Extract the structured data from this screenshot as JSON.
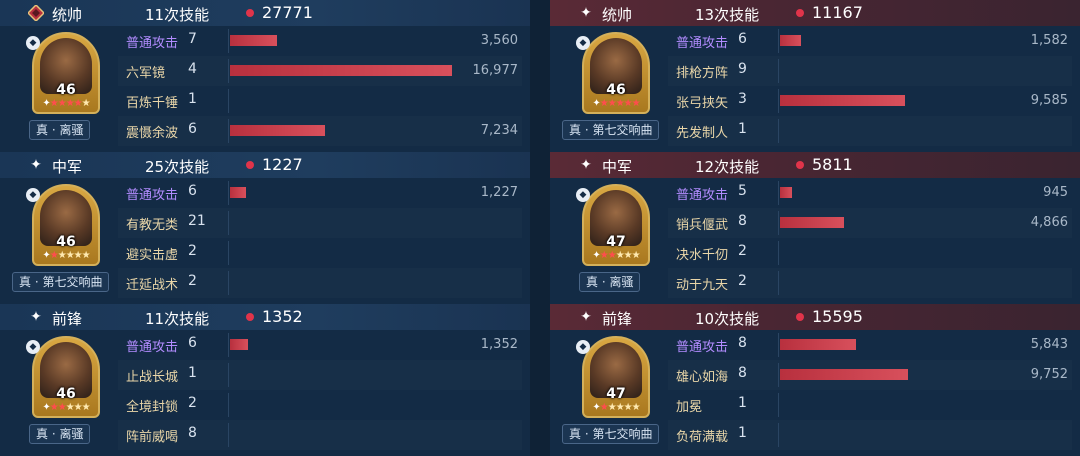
{
  "max_damage": 16977,
  "teams": [
    {
      "side": "left",
      "sections": [
        {
          "role": "统帅",
          "role_icon": "diamond-emblem-icon",
          "skill_count": "11次技能",
          "total": "27771",
          "level": "46",
          "stars_on": 4,
          "tactic": "真 · 离骚",
          "skills": [
            {
              "name": "普通攻击",
              "count": "7",
              "damage": 3560,
              "damage_text": "3,560",
              "basic": true
            },
            {
              "name": "六军镜",
              "count": "4",
              "damage": 16977,
              "damage_text": "16,977"
            },
            {
              "name": "百炼千锤",
              "count": "1",
              "damage": 0,
              "damage_text": ""
            },
            {
              "name": "震慑余波",
              "count": "6",
              "damage": 7234,
              "damage_text": "7,234"
            }
          ]
        },
        {
          "role": "中军",
          "role_icon": "star-icon",
          "skill_count": "25次技能",
          "total": "1227",
          "level": "46",
          "stars_on": 1,
          "tactic": "真 · 第七交响曲",
          "skills": [
            {
              "name": "普通攻击",
              "count": "6",
              "damage": 1227,
              "damage_text": "1,227",
              "basic": true
            },
            {
              "name": "有教无类",
              "count": "21",
              "damage": 0,
              "damage_text": ""
            },
            {
              "name": "避实击虚",
              "count": "2",
              "damage": 0,
              "damage_text": ""
            },
            {
              "name": "迁延战术",
              "count": "2",
              "damage": 0,
              "damage_text": ""
            }
          ]
        },
        {
          "role": "前锋",
          "role_icon": "star-icon",
          "skill_count": "11次技能",
          "total": "1352",
          "level": "46",
          "stars_on": 2,
          "tactic": "真 · 离骚",
          "skills": [
            {
              "name": "普通攻击",
              "count": "6",
              "damage": 1352,
              "damage_text": "1,352",
              "basic": true
            },
            {
              "name": "止战长城",
              "count": "1",
              "damage": 0,
              "damage_text": ""
            },
            {
              "name": "全境封锁",
              "count": "2",
              "damage": 0,
              "damage_text": ""
            },
            {
              "name": "阵前威喝",
              "count": "8",
              "damage": 0,
              "damage_text": ""
            }
          ]
        }
      ]
    },
    {
      "side": "right",
      "sections": [
        {
          "role": "统帅",
          "role_icon": "star-icon",
          "skill_count": "13次技能",
          "total": "11167",
          "level": "46",
          "stars_on": 5,
          "tactic": "真 · 第七交响曲",
          "skills": [
            {
              "name": "普通攻击",
              "count": "6",
              "damage": 1582,
              "damage_text": "1,582",
              "basic": true
            },
            {
              "name": "排枪方阵",
              "count": "9",
              "damage": 0,
              "damage_text": ""
            },
            {
              "name": "张弓挟矢",
              "count": "3",
              "damage": 9585,
              "damage_text": "9,585"
            },
            {
              "name": "先发制人",
              "count": "1",
              "damage": 0,
              "damage_text": ""
            }
          ]
        },
        {
          "role": "中军",
          "role_icon": "star-icon",
          "skill_count": "12次技能",
          "total": "5811",
          "level": "47",
          "stars_on": 2,
          "tactic": "真 · 离骚",
          "skills": [
            {
              "name": "普通攻击",
              "count": "5",
              "damage": 945,
              "damage_text": "945",
              "basic": true
            },
            {
              "name": "销兵偃武",
              "count": "8",
              "damage": 4866,
              "damage_text": "4,866"
            },
            {
              "name": "决水千仞",
              "count": "2",
              "damage": 0,
              "damage_text": ""
            },
            {
              "name": "动于九天",
              "count": "2",
              "damage": 0,
              "damage_text": ""
            }
          ]
        },
        {
          "role": "前锋",
          "role_icon": "star-icon",
          "skill_count": "10次技能",
          "total": "15595",
          "level": "47",
          "stars_on": 1,
          "tactic": "真 · 第七交响曲",
          "skills": [
            {
              "name": "普通攻击",
              "count": "8",
              "damage": 5843,
              "damage_text": "5,843",
              "basic": true
            },
            {
              "name": "雄心如海",
              "count": "8",
              "damage": 9752,
              "damage_text": "9,752"
            },
            {
              "name": "加冕",
              "count": "1",
              "damage": 0,
              "damage_text": ""
            },
            {
              "name": "负荷满载",
              "count": "1",
              "damage": 0,
              "damage_text": ""
            }
          ]
        }
      ]
    }
  ]
}
